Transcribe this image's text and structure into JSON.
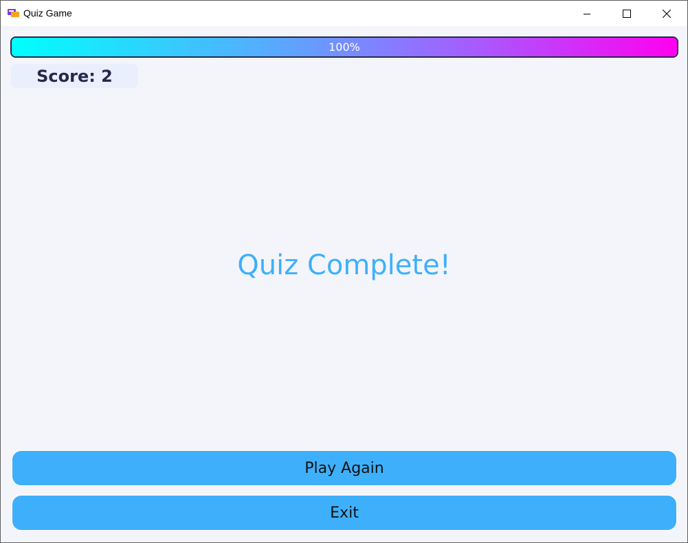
{
  "window": {
    "title": "Quiz Game",
    "icon": "quiz-app-icon"
  },
  "progress": {
    "value": 1.0,
    "label": "100%",
    "colors": [
      "#00ffff",
      "#ff00f0"
    ]
  },
  "score": {
    "label": "Score: 2"
  },
  "main": {
    "heading": "Quiz Complete!"
  },
  "actions": {
    "play_again": "Play Again",
    "exit": "Exit"
  },
  "theme": {
    "accent": "#3eb0fb",
    "background": "#f4f5fb",
    "dark": "#25294a"
  }
}
